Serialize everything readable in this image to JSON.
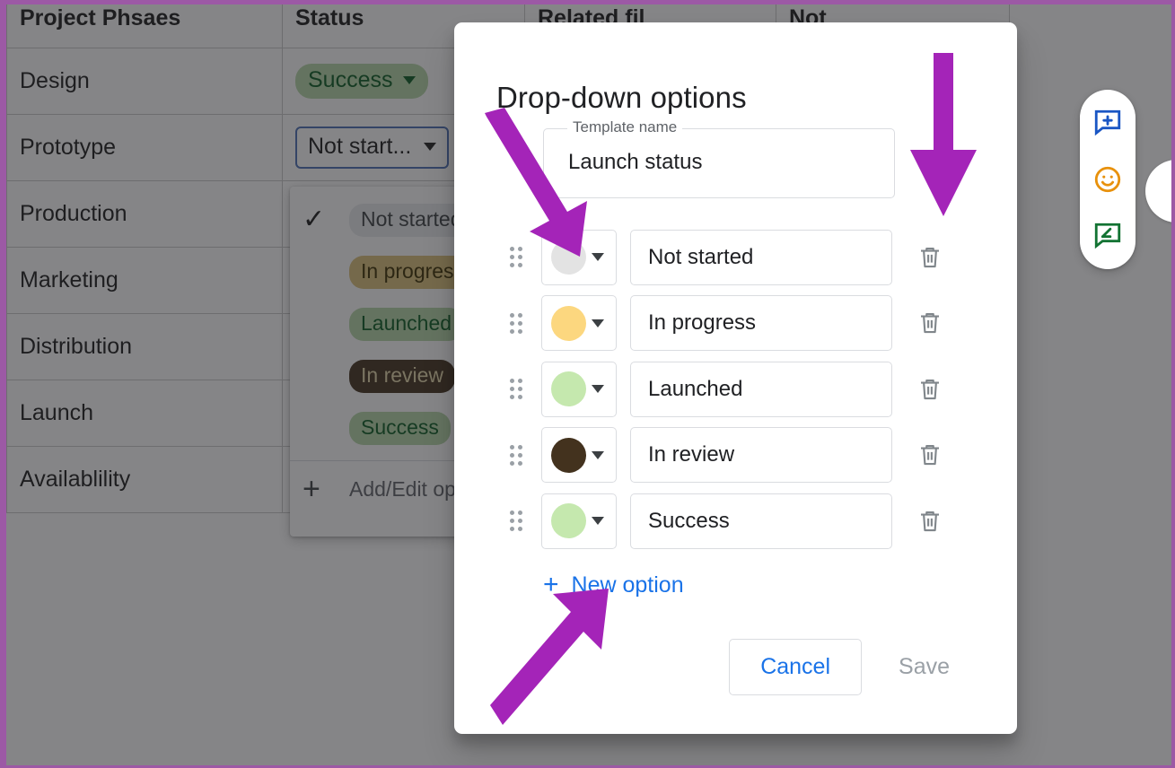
{
  "page": {
    "frame_color": "#9c59a5",
    "annotation_arrow_color": "#A424B8"
  },
  "sheet": {
    "headers": [
      "Project Phsaes",
      "Status",
      "Related fil",
      "Not"
    ],
    "rows": [
      {
        "phase": "Design",
        "status": "Success",
        "status_style": "chip-success"
      },
      {
        "phase": "Prototype",
        "status": "Not start...",
        "status_style": "chip-open"
      },
      {
        "phase": "Production",
        "status": "",
        "status_style": ""
      },
      {
        "phase": "Marketing",
        "status": "",
        "status_style": ""
      },
      {
        "phase": "Distribution",
        "status": "",
        "status_style": ""
      },
      {
        "phase": "Launch",
        "status": "",
        "status_style": ""
      },
      {
        "phase": "Availablility",
        "status": "",
        "status_style": ""
      }
    ]
  },
  "dropdown": {
    "items": [
      {
        "label": "Not started",
        "checked": true,
        "bg": "#e8eaed",
        "fg": "#3c4043"
      },
      {
        "label": "In progress",
        "checked": false,
        "bg": "#fcd77f",
        "fg": "#3c2f00"
      },
      {
        "label": "Launched",
        "checked": false,
        "bg": "#c5e8ae",
        "fg": "#0b5c22"
      },
      {
        "label": "In review",
        "checked": false,
        "bg": "#43321e",
        "fg": "#f3e6c9"
      },
      {
        "label": "Success",
        "checked": false,
        "bg": "#c5e8ae",
        "fg": "#0b5c22"
      }
    ],
    "check_glyph": "✓",
    "add_edit_label": "Add/Edit op",
    "add_plus": "+"
  },
  "comment_toolbar": {
    "buttons": [
      {
        "name": "add-comment-icon",
        "color": "#1a56c4"
      },
      {
        "name": "add-emoji-reaction-icon",
        "color": "#e8910c"
      },
      {
        "name": "suggest-edit-icon",
        "color": "#137333"
      }
    ]
  },
  "modal": {
    "title": "Drop-down options",
    "template_field": {
      "label": "Template name",
      "value": "Launch status",
      "placeholder": "Template name"
    },
    "options": [
      {
        "color": "#e3e3e3",
        "name": "Not started"
      },
      {
        "color": "#fcd77f",
        "name": "In progress"
      },
      {
        "color": "#c5e8ae",
        "name": "Launched"
      },
      {
        "color": "#43321e",
        "name": "In review"
      },
      {
        "color": "#c5e8ae",
        "name": "Success"
      }
    ],
    "new_option": {
      "plus": "+",
      "label": "New option"
    },
    "actions": {
      "cancel": "Cancel",
      "save": "Save"
    }
  }
}
